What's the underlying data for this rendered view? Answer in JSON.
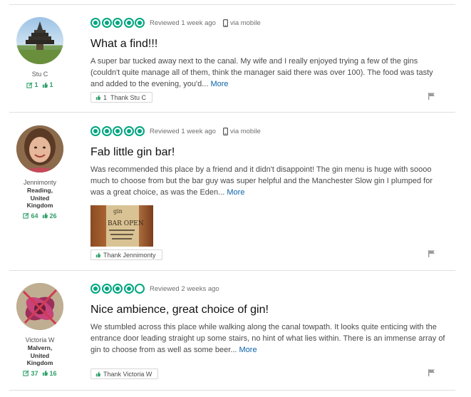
{
  "reviews": [
    {
      "user": {
        "name": "Stu C",
        "location_lines": [],
        "contributions": "1",
        "helpful_votes": "1"
      },
      "rating": 5,
      "date": "Reviewed 1 week ago",
      "via": "via mobile",
      "title": "What a find!!!",
      "body": "A super bar tucked away next to the canal. My wife and I really enjoyed trying a few of the gins (couldn't quite manage all of them, think the manager said there was over 100). The food was tasty and added to the evening, you'd...",
      "more": "More",
      "thank_count": "1",
      "thank_label": "Thank Stu C",
      "icons": {
        "avatar": "temple-avatar",
        "flag": "flag-icon"
      }
    },
    {
      "user": {
        "name": "Jennimonty",
        "location_lines": [
          "Reading,",
          "United",
          "Kingdom"
        ],
        "contributions": "64",
        "helpful_votes": "26"
      },
      "rating": 5,
      "date": "Reviewed 1 week ago",
      "via": "via mobile",
      "title": "Fab little gin bar!",
      "body": "Was recommended this place by a friend and it didn't disappoint! The gin menu is huge with soooo much to choose from but the bar guy was super helpful and the Manchester Slow gin I plumped for was a great choice, as was the Eden...",
      "more": "More",
      "photo_text": [
        "gin",
        "BAR OPEN"
      ],
      "thank_count": "",
      "thank_label": "Thank Jennimonty",
      "icons": {
        "avatar": "woman-avatar",
        "flag": "flag-icon"
      }
    },
    {
      "user": {
        "name": "Victoria W",
        "location_lines": [
          "Malvern,",
          "United",
          "Kingdom"
        ],
        "contributions": "37",
        "helpful_votes": "16"
      },
      "rating": 4,
      "date": "Reviewed 2 weeks ago",
      "via": "",
      "title": "Nice ambience, great choice of gin!",
      "body": "We stumbled across this place while walking along the canal towpath. It looks quite enticing with the entrance door leading straight up some stairs, no hint of what lies within. There is an immense array of gin to choose from as well as some beer...",
      "more": "More",
      "thank_count": "",
      "thank_label": "Thank Victoria W",
      "icons": {
        "avatar": "flower-avatar",
        "flag": "flag-icon"
      }
    }
  ],
  "colors": {
    "accent": "#00a680",
    "link": "#0b62a8",
    "stat": "#2e9f69"
  }
}
